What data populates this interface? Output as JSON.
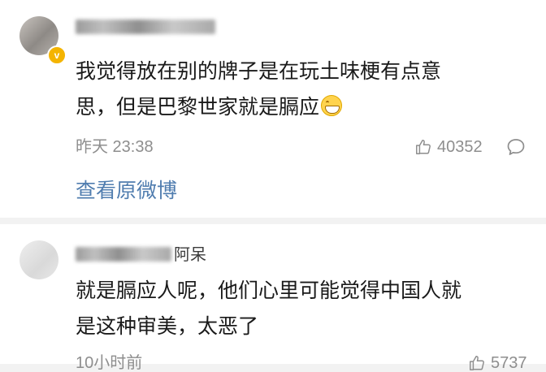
{
  "comments": [
    {
      "name_visible": "",
      "verified": true,
      "text_line1": "我觉得放在别的牌子是在玩土味梗有点意",
      "text_line2": "思，但是巴黎世家就是膈应",
      "emoji": "grinning-face-icon",
      "time": "昨天 23:38",
      "likes": "40352",
      "view_original": "查看原微博"
    },
    {
      "name_visible": "阿呆",
      "verified": false,
      "text_line1": "就是膈应人呢，他们心里可能觉得中国人就",
      "text_line2": "是这种审美，太恶了",
      "time": "10小时前",
      "likes": "5737"
    }
  ],
  "colors": {
    "link": "#507daf",
    "meta": "#8e8e8e",
    "text": "#1a1a1a",
    "background": "#f2f2f2",
    "verified_badge": "#f4b400"
  }
}
